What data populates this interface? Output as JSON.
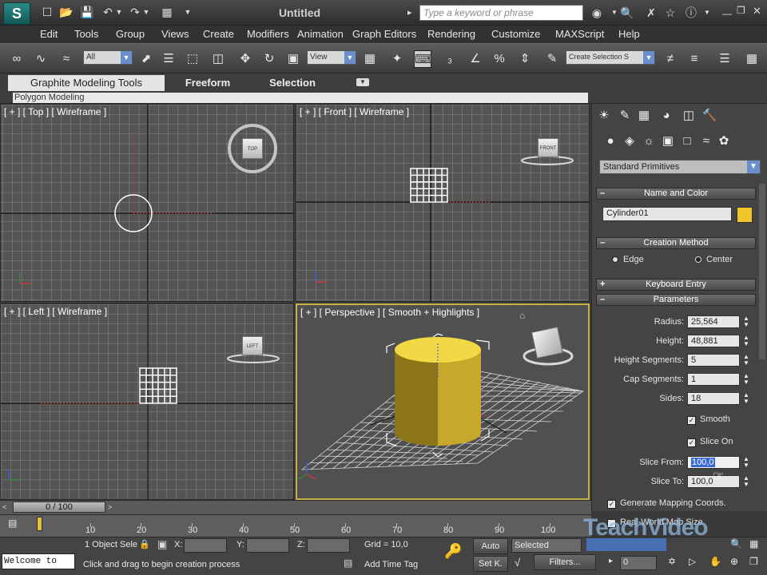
{
  "title_bar": {
    "title": "Untitled",
    "search_placeholder": "Type a keyword or phrase",
    "logo_char": "S"
  },
  "menu": [
    "Edit",
    "Tools",
    "Group",
    "Views",
    "Create",
    "Modifiers",
    "Animation",
    "Graph Editors",
    "Rendering",
    "Customize",
    "MAXScript",
    "Help"
  ],
  "toolbar": {
    "selection_filter": "All",
    "ref_coord": "View",
    "named_selection": "Create Selection S"
  },
  "ribbon": {
    "tabs": [
      "Graphite Modeling Tools",
      "Freeform",
      "Selection"
    ],
    "sub_label": "Polygon Modeling"
  },
  "viewports": {
    "top": "[ + ] [ Top ] [ Wireframe ]",
    "front": "[ + ] [ Front ] [ Wireframe ]",
    "left": "[ + ] [ Left ] [ Wireframe ]",
    "perspective": "[ + ] [ Perspective ] [ Smooth + Highlights ]",
    "viewcube_top": "TOP",
    "viewcube_front": "FRONT",
    "viewcube_left": "LEFT"
  },
  "command_panel": {
    "category": "Standard Primitives",
    "name_and_color_label": "Name and Color",
    "object_name": "Cylinder01",
    "object_color": "#f2c62a",
    "creation_method_label": "Creation Method",
    "creation_edge": "Edge",
    "creation_center": "Center",
    "keyboard_entry_label": "Keyboard Entry",
    "parameters_label": "Parameters",
    "radius_label": "Radius:",
    "radius": "25,564",
    "height_label": "Height:",
    "height": "48,881",
    "height_segments_label": "Height Segments:",
    "height_segments": "5",
    "cap_segments_label": "Cap Segments:",
    "cap_segments": "1",
    "sides_label": "Sides:",
    "sides": "18",
    "smooth_label": "Smooth",
    "slice_on_label": "Slice On",
    "slice_from_label": "Slice From:",
    "slice_from": "100,0",
    "slice_to_label": "Slice To:",
    "slice_to": "100,0",
    "gen_mapping_label": "Generate Mapping Coords.",
    "real_world_label": "Real-World Map Size"
  },
  "timeline": {
    "slider_label": "0 / 100",
    "ticks": [
      "10",
      "20",
      "30",
      "40",
      "50",
      "60",
      "70",
      "80",
      "90",
      "100"
    ]
  },
  "status": {
    "maxscript_text": "Welcome to",
    "selection_count": "1 Object Sele",
    "x_label": "X:",
    "y_label": "Y:",
    "z_label": "Z:",
    "grid": "Grid = 10,0",
    "auto": "Auto",
    "set_key": "Set K.",
    "selected": "Selected",
    "filters": "Filters...",
    "key_frame": "0",
    "prompt": "Click and drag to begin creation process",
    "add_time_tag": "Add Time Tag"
  },
  "watermark": "TeachVideo"
}
